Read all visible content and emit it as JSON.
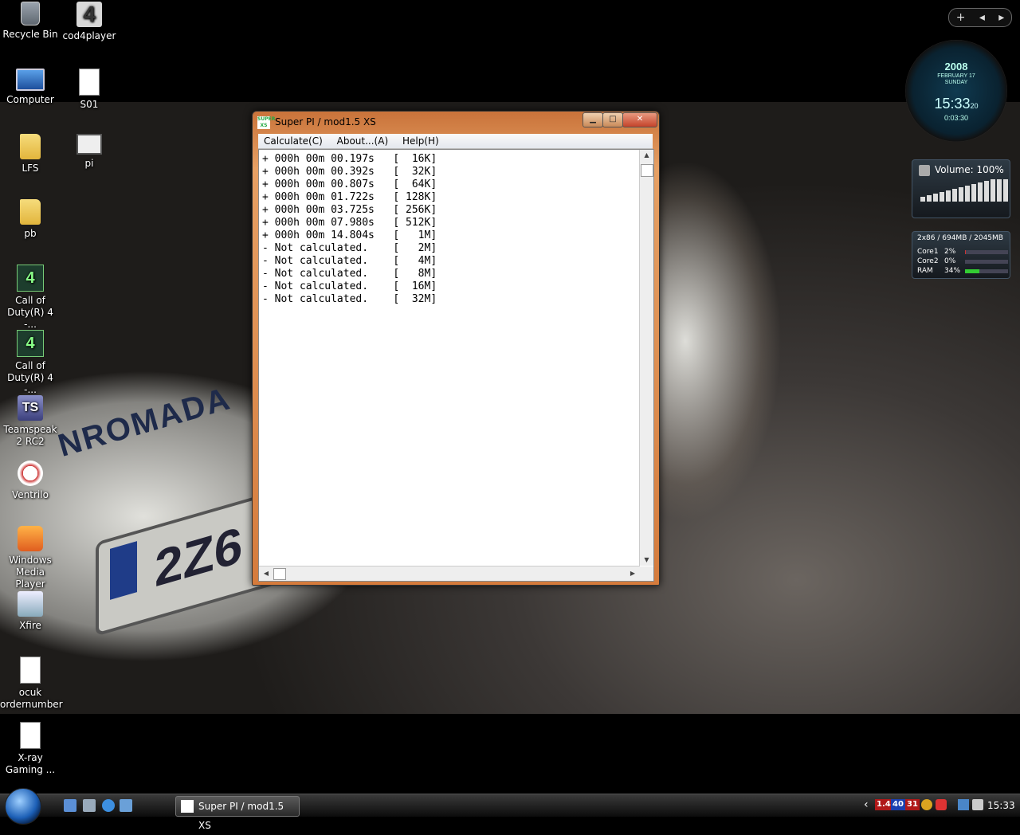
{
  "desktop_icons": [
    {
      "label": "Recycle Bin"
    },
    {
      "label": "cod4player"
    },
    {
      "label": "Computer"
    },
    {
      "label": "S01"
    },
    {
      "label": "LFS"
    },
    {
      "label": "pi"
    },
    {
      "label": "pb"
    },
    {
      "label": "Call of Duty(R) 4 -..."
    },
    {
      "label": "Call of Duty(R) 4 -..."
    },
    {
      "label": "Teamspeak 2 RC2"
    },
    {
      "label": "Ventrilo"
    },
    {
      "label": "Windows Media Player"
    },
    {
      "label": "Xfire"
    },
    {
      "label": "ocuk ordernumber"
    },
    {
      "label": "X-ray Gaming ..."
    }
  ],
  "wallpaper": {
    "brand_text": "NROMADA",
    "plate_text": "2Z6"
  },
  "sidebar_controls": {
    "add": "+",
    "prev": "◂",
    "next": "▸"
  },
  "clock_gadget": {
    "year": "2008",
    "date": "FEBRUARY 17",
    "day": "SUNDAY",
    "time": "15:33",
    "seconds": "20",
    "footer": "0:03:30"
  },
  "volume_gadget": {
    "title": "Volume: 100%"
  },
  "sysmon_gadget": {
    "header": "2x86 / 694MB / 2045MB",
    "rows": [
      {
        "name": "Core1",
        "value": "2%",
        "level": 0.02
      },
      {
        "name": "Core2",
        "value": "0%",
        "level": 0.0
      },
      {
        "name": "RAM",
        "value": "34%",
        "level": 0.34
      }
    ]
  },
  "window": {
    "title": "Super PI / mod1.5 XS",
    "icon_text": "SUPER XS",
    "controls": {
      "minimize": "▁",
      "maximize": "□",
      "close": "✕"
    },
    "menu": [
      "Calculate(C)",
      "About...(A)",
      "Help(H)"
    ],
    "output_lines": [
      "+ 000h 00m 00.197s   [  16K]",
      "+ 000h 00m 00.392s   [  32K]",
      "+ 000h 00m 00.807s   [  64K]",
      "+ 000h 00m 01.722s   [ 128K]",
      "+ 000h 00m 03.725s   [ 256K]",
      "+ 000h 00m 07.980s   [ 512K]",
      "+ 000h 00m 14.804s   [   1M]",
      "- Not calculated.    [   2M]",
      "- Not calculated.    [   4M]",
      "- Not calculated.    [   8M]",
      "- Not calculated.    [  16M]",
      "- Not calculated.    [  32M]"
    ]
  },
  "taskbar": {
    "task_label": "Super PI / mod1.5 XS",
    "tray_badges": [
      "1.4",
      "40",
      "31"
    ],
    "badge_colors": [
      "#b01818",
      "#1a3fb0",
      "#b01818"
    ],
    "tray_arrow": "‹",
    "clock": "15:33"
  }
}
